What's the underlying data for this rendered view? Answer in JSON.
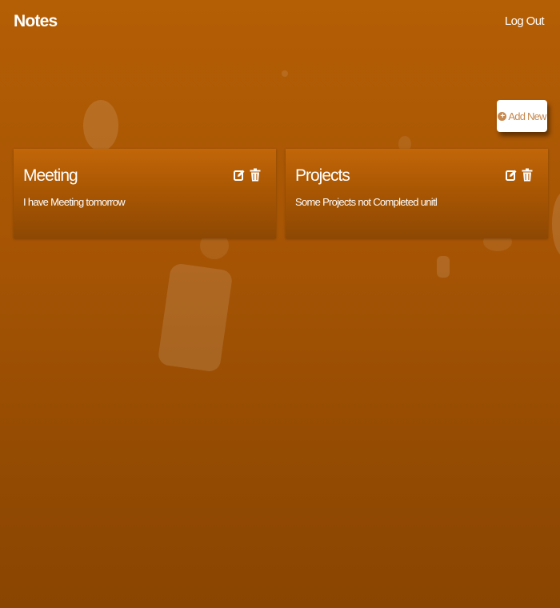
{
  "header": {
    "brand": "Notes",
    "logout_label": "Log Out"
  },
  "actions": {
    "add_new_label": "Add New",
    "add_new_icon": "plus-circle-icon"
  },
  "notes": [
    {
      "title": "Meeting",
      "body": "I have Meeting tomorrow",
      "edit_icon": "edit-icon",
      "delete_icon": "trash-icon"
    },
    {
      "title": "Projects",
      "body": "Some Projects not Completed unitl",
      "edit_icon": "edit-icon",
      "delete_icon": "trash-icon"
    }
  ],
  "colors": {
    "background_top": "#b45e05",
    "background_bottom": "#8a4502",
    "card_top": "#c26609",
    "add_button_text": "#c7884e"
  }
}
